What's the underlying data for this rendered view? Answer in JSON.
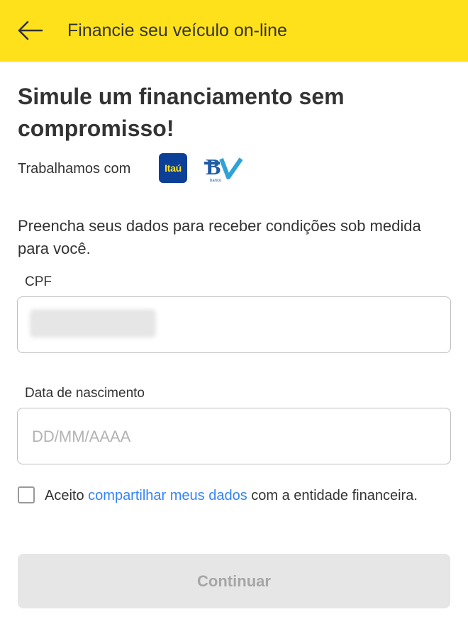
{
  "appbar": {
    "back_icon": "arrow-left-icon",
    "title": "Financie seu veículo on-line",
    "background_color": "#ffe11b"
  },
  "headline": "Simule um financiamento sem compromisso!",
  "partners": {
    "label": "Trabalhamos com",
    "logos": [
      {
        "name": "itau-logo",
        "text": "Itaú"
      },
      {
        "name": "bv-logo",
        "text": "BV",
        "subtext": "banco"
      }
    ]
  },
  "intro": "Preencha seus dados para receber condições sob medida para você.",
  "form": {
    "cpf": {
      "label": "CPF",
      "value": "",
      "value_redacted": true
    },
    "birthdate": {
      "label": "Data de nascimento",
      "placeholder": "DD/MM/AAAA",
      "value": ""
    },
    "consent": {
      "checked": false,
      "prefix": "Aceito",
      "link_text": "compartilhar meus dados",
      "suffix": "com a entidade financeira."
    }
  },
  "continue_button": {
    "label": "Continuar",
    "enabled": false
  },
  "colors": {
    "accent_yellow": "#ffe11b",
    "link_blue": "#3483fa",
    "disabled_bg": "#e6e6e6",
    "disabled_text": "#a6a6a6"
  }
}
